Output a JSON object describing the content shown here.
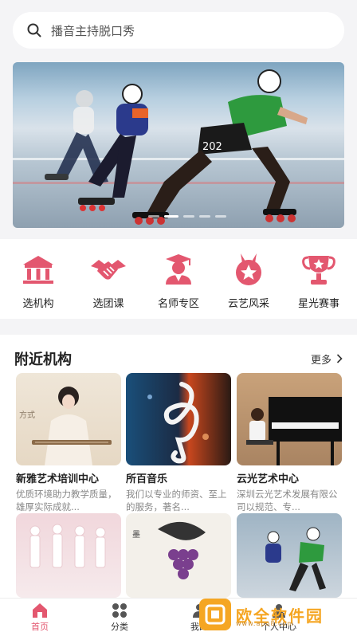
{
  "search": {
    "placeholder": "播音主持脱口秀"
  },
  "banner": {
    "slides": 5,
    "active_slide": 1,
    "bib_number": "202"
  },
  "categories": [
    {
      "label": "选机构",
      "icon": "institution-icon"
    },
    {
      "label": "选团课",
      "icon": "handshake-icon"
    },
    {
      "label": "名师专区",
      "icon": "teacher-icon"
    },
    {
      "label": "云艺风采",
      "icon": "medal-icon"
    },
    {
      "label": "星光赛事",
      "icon": "trophy-icon"
    }
  ],
  "nearby": {
    "title": "附近机构",
    "more": "更多",
    "items": [
      {
        "name": "新雅艺术培训中心",
        "desc": "优质环境助力教学质量，雄厚实际成就..."
      },
      {
        "name": "所百音乐",
        "desc": "我们以专业的师资、至上的服务，著名..."
      },
      {
        "name": "云光艺术中心",
        "desc": "深圳云光艺术发展有限公司以规范、专..."
      }
    ]
  },
  "tabbar": [
    {
      "label": "首页",
      "active": true
    },
    {
      "label": "分类",
      "active": false
    },
    {
      "label": "我的",
      "active": false
    },
    {
      "label": "个人中心",
      "active": false
    }
  ],
  "watermark": {
    "text": "欧全软件园",
    "url": "www.apo8.com"
  },
  "colors": {
    "accent": "#e3576f",
    "watermark": "#f5a623"
  }
}
